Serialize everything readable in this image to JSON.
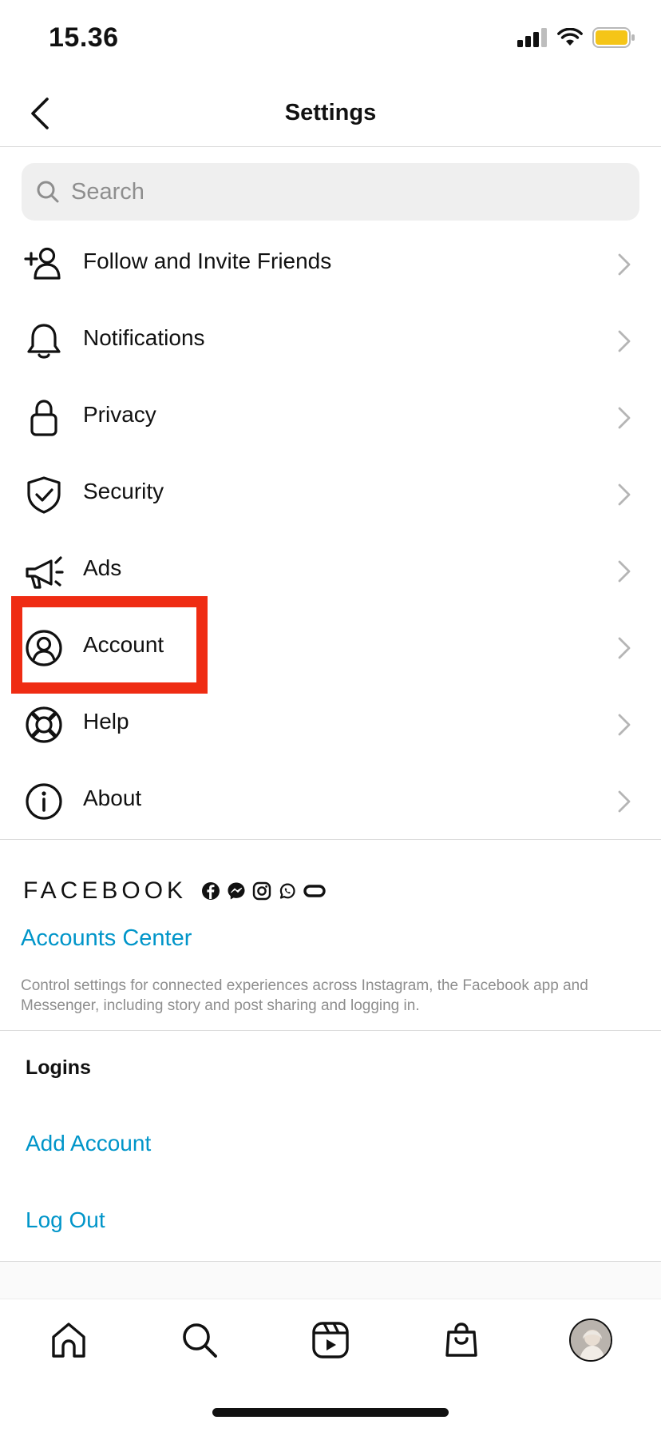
{
  "status_bar": {
    "time": "15.36"
  },
  "header": {
    "title": "Settings"
  },
  "search": {
    "placeholder": "Search"
  },
  "menu": [
    {
      "label": "Follow and Invite Friends",
      "icon": "add-person-icon"
    },
    {
      "label": "Notifications",
      "icon": "bell-icon"
    },
    {
      "label": "Privacy",
      "icon": "lock-icon"
    },
    {
      "label": "Security",
      "icon": "shield-check-icon"
    },
    {
      "label": "Ads",
      "icon": "megaphone-icon"
    },
    {
      "label": "Account",
      "icon": "account-circle-icon"
    },
    {
      "label": "Help",
      "icon": "lifebuoy-icon"
    },
    {
      "label": "About",
      "icon": "info-icon"
    }
  ],
  "facebook": {
    "wordmark": "FACEBOOK",
    "accounts_center": "Accounts Center",
    "description": "Control settings for connected experiences across Instagram, the Facebook app and Messenger, including story and post sharing and logging in.",
    "app_icons": [
      "facebook-icon",
      "messenger-icon",
      "instagram-icon",
      "whatsapp-icon",
      "oculus-icon"
    ]
  },
  "logins": {
    "heading": "Logins",
    "add_account": "Add Account",
    "log_out": "Log Out"
  },
  "tab_bar": [
    "home-icon",
    "search-icon",
    "reels-icon",
    "shop-icon",
    "profile-avatar"
  ],
  "colors": {
    "link": "#0095c9",
    "highlight": "#ef2c13",
    "battery": "#f5c518"
  }
}
